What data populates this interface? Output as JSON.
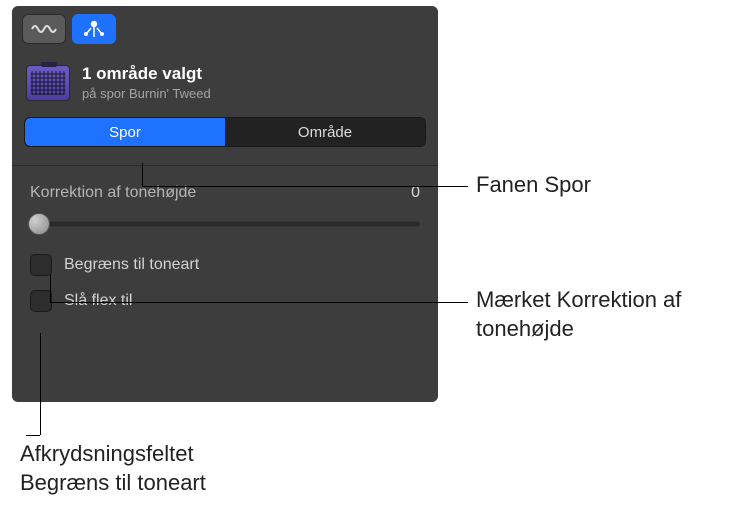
{
  "header": {
    "selection_title": "1 område valgt",
    "selection_subtitle": "på spor Burnin' Tweed"
  },
  "tabs": {
    "spor": "Spor",
    "omrade": "Område"
  },
  "pitch": {
    "label": "Korrektion af tonehøjde",
    "value": "0"
  },
  "checks": {
    "limit_key": "Begræns til toneart",
    "enable_flex": "Slå flex til"
  },
  "callouts": {
    "spor_tab": "Fanen Spor",
    "pitch_slider": "Mærket Korrektion af tonehøjde",
    "limit_checkbox": "Afkrydsningsfeltet Begræns til toneart"
  }
}
